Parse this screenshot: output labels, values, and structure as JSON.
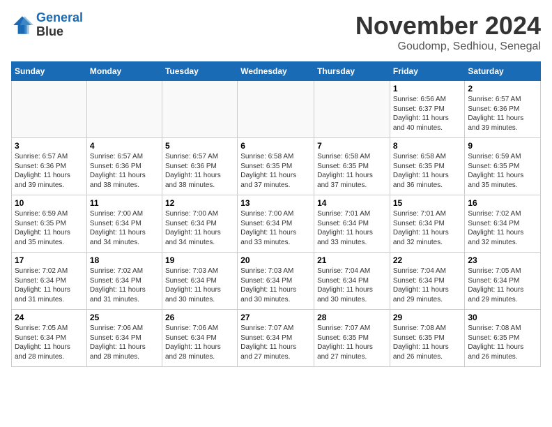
{
  "logo": {
    "line1": "General",
    "line2": "Blue"
  },
  "title": "November 2024",
  "location": "Goudomp, Sedhiou, Senegal",
  "days_of_week": [
    "Sunday",
    "Monday",
    "Tuesday",
    "Wednesday",
    "Thursday",
    "Friday",
    "Saturday"
  ],
  "weeks": [
    [
      {
        "day": "",
        "detail": ""
      },
      {
        "day": "",
        "detail": ""
      },
      {
        "day": "",
        "detail": ""
      },
      {
        "day": "",
        "detail": ""
      },
      {
        "day": "",
        "detail": ""
      },
      {
        "day": "1",
        "detail": "Sunrise: 6:56 AM\nSunset: 6:37 PM\nDaylight: 11 hours\nand 40 minutes."
      },
      {
        "day": "2",
        "detail": "Sunrise: 6:57 AM\nSunset: 6:36 PM\nDaylight: 11 hours\nand 39 minutes."
      }
    ],
    [
      {
        "day": "3",
        "detail": "Sunrise: 6:57 AM\nSunset: 6:36 PM\nDaylight: 11 hours\nand 39 minutes."
      },
      {
        "day": "4",
        "detail": "Sunrise: 6:57 AM\nSunset: 6:36 PM\nDaylight: 11 hours\nand 38 minutes."
      },
      {
        "day": "5",
        "detail": "Sunrise: 6:57 AM\nSunset: 6:36 PM\nDaylight: 11 hours\nand 38 minutes."
      },
      {
        "day": "6",
        "detail": "Sunrise: 6:58 AM\nSunset: 6:35 PM\nDaylight: 11 hours\nand 37 minutes."
      },
      {
        "day": "7",
        "detail": "Sunrise: 6:58 AM\nSunset: 6:35 PM\nDaylight: 11 hours\nand 37 minutes."
      },
      {
        "day": "8",
        "detail": "Sunrise: 6:58 AM\nSunset: 6:35 PM\nDaylight: 11 hours\nand 36 minutes."
      },
      {
        "day": "9",
        "detail": "Sunrise: 6:59 AM\nSunset: 6:35 PM\nDaylight: 11 hours\nand 35 minutes."
      }
    ],
    [
      {
        "day": "10",
        "detail": "Sunrise: 6:59 AM\nSunset: 6:35 PM\nDaylight: 11 hours\nand 35 minutes."
      },
      {
        "day": "11",
        "detail": "Sunrise: 7:00 AM\nSunset: 6:34 PM\nDaylight: 11 hours\nand 34 minutes."
      },
      {
        "day": "12",
        "detail": "Sunrise: 7:00 AM\nSunset: 6:34 PM\nDaylight: 11 hours\nand 34 minutes."
      },
      {
        "day": "13",
        "detail": "Sunrise: 7:00 AM\nSunset: 6:34 PM\nDaylight: 11 hours\nand 33 minutes."
      },
      {
        "day": "14",
        "detail": "Sunrise: 7:01 AM\nSunset: 6:34 PM\nDaylight: 11 hours\nand 33 minutes."
      },
      {
        "day": "15",
        "detail": "Sunrise: 7:01 AM\nSunset: 6:34 PM\nDaylight: 11 hours\nand 32 minutes."
      },
      {
        "day": "16",
        "detail": "Sunrise: 7:02 AM\nSunset: 6:34 PM\nDaylight: 11 hours\nand 32 minutes."
      }
    ],
    [
      {
        "day": "17",
        "detail": "Sunrise: 7:02 AM\nSunset: 6:34 PM\nDaylight: 11 hours\nand 31 minutes."
      },
      {
        "day": "18",
        "detail": "Sunrise: 7:02 AM\nSunset: 6:34 PM\nDaylight: 11 hours\nand 31 minutes."
      },
      {
        "day": "19",
        "detail": "Sunrise: 7:03 AM\nSunset: 6:34 PM\nDaylight: 11 hours\nand 30 minutes."
      },
      {
        "day": "20",
        "detail": "Sunrise: 7:03 AM\nSunset: 6:34 PM\nDaylight: 11 hours\nand 30 minutes."
      },
      {
        "day": "21",
        "detail": "Sunrise: 7:04 AM\nSunset: 6:34 PM\nDaylight: 11 hours\nand 30 minutes."
      },
      {
        "day": "22",
        "detail": "Sunrise: 7:04 AM\nSunset: 6:34 PM\nDaylight: 11 hours\nand 29 minutes."
      },
      {
        "day": "23",
        "detail": "Sunrise: 7:05 AM\nSunset: 6:34 PM\nDaylight: 11 hours\nand 29 minutes."
      }
    ],
    [
      {
        "day": "24",
        "detail": "Sunrise: 7:05 AM\nSunset: 6:34 PM\nDaylight: 11 hours\nand 28 minutes."
      },
      {
        "day": "25",
        "detail": "Sunrise: 7:06 AM\nSunset: 6:34 PM\nDaylight: 11 hours\nand 28 minutes."
      },
      {
        "day": "26",
        "detail": "Sunrise: 7:06 AM\nSunset: 6:34 PM\nDaylight: 11 hours\nand 28 minutes."
      },
      {
        "day": "27",
        "detail": "Sunrise: 7:07 AM\nSunset: 6:34 PM\nDaylight: 11 hours\nand 27 minutes."
      },
      {
        "day": "28",
        "detail": "Sunrise: 7:07 AM\nSunset: 6:35 PM\nDaylight: 11 hours\nand 27 minutes."
      },
      {
        "day": "29",
        "detail": "Sunrise: 7:08 AM\nSunset: 6:35 PM\nDaylight: 11 hours\nand 26 minutes."
      },
      {
        "day": "30",
        "detail": "Sunrise: 7:08 AM\nSunset: 6:35 PM\nDaylight: 11 hours\nand 26 minutes."
      }
    ]
  ]
}
